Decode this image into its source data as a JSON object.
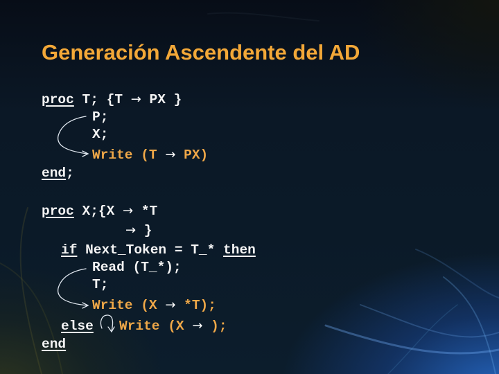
{
  "title": "Generación Ascendente del AD",
  "colors": {
    "title": "#f3a838",
    "code": "#f4f4f4",
    "action": "#f0a848",
    "background": "#0b1826"
  },
  "block1": {
    "header": {
      "kw": "proc",
      "name": " T; {T ",
      "arrow": "→",
      "rest": " PX }"
    },
    "line_p": "P;",
    "line_x": "X;",
    "write": {
      "pre": "Write (T ",
      "arrow": "→",
      "post": " PX)"
    },
    "end": {
      "kw": "end",
      "rest": ";"
    }
  },
  "block2": {
    "header": {
      "kw": "proc",
      "name": " X;{X ",
      "arrow": "→",
      "rest": " *T"
    },
    "alt": {
      "arrow": "→",
      "rest": " }"
    },
    "if_line": {
      "kw_if": "if",
      "cond": " Next_Token = T_* ",
      "kw_then": "then"
    },
    "read": "Read (T_*);",
    "call_t": "T;",
    "write1": {
      "pre": "Write (X ",
      "arrow": "→",
      "post": " *T);"
    },
    "else": {
      "kw": "else"
    },
    "write2": {
      "pre": "Write (X ",
      "arrow": "→",
      "post": " );"
    },
    "end": {
      "kw": "end"
    }
  },
  "icons": [
    "curved-arrow-block1",
    "curved-arrow-block2",
    "loop-arrow-else"
  ]
}
